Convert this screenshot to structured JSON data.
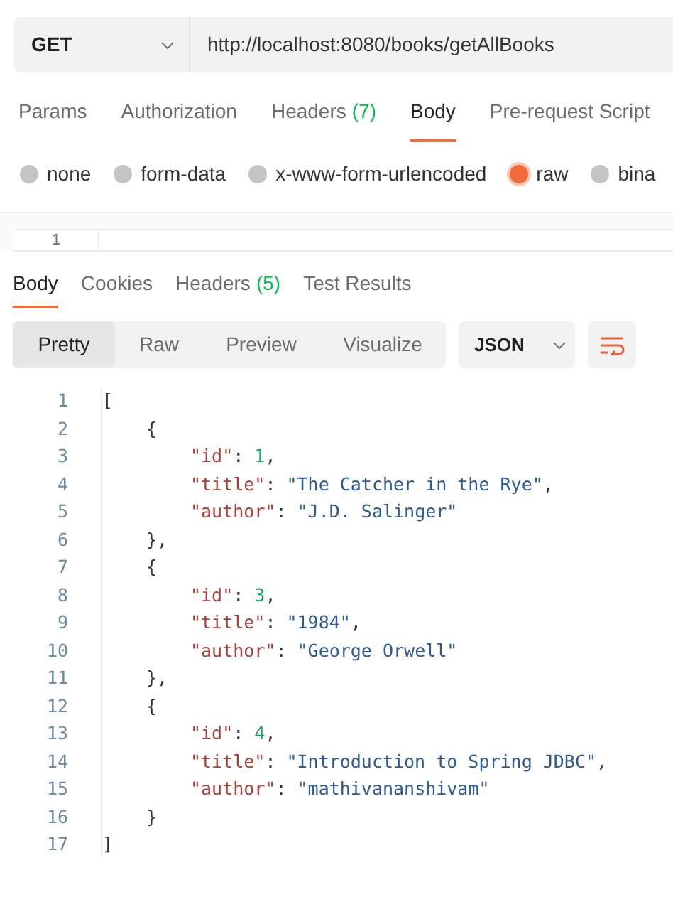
{
  "request": {
    "method": "GET",
    "url": "http://localhost:8080/books/getAllBooks"
  },
  "request_tabs": [
    {
      "label": "Params",
      "selected": false
    },
    {
      "label": "Authorization",
      "selected": false
    },
    {
      "label": "Headers",
      "count": "(7)",
      "selected": false
    },
    {
      "label": "Body",
      "selected": true
    },
    {
      "label": "Pre-request Script",
      "selected": false
    }
  ],
  "body_types": [
    {
      "label": "none",
      "selected": false
    },
    {
      "label": "form-data",
      "selected": false
    },
    {
      "label": "x-www-form-urlencoded",
      "selected": false
    },
    {
      "label": "raw",
      "selected": true
    },
    {
      "label": "bina",
      "selected": false
    }
  ],
  "request_editor": {
    "line_number": "1"
  },
  "response_tabs": [
    {
      "label": "Body",
      "selected": true
    },
    {
      "label": "Cookies",
      "selected": false
    },
    {
      "label": "Headers",
      "count": "(5)",
      "selected": false
    },
    {
      "label": "Test Results",
      "selected": false
    }
  ],
  "view_modes": [
    {
      "label": "Pretty",
      "selected": true
    },
    {
      "label": "Raw",
      "selected": false
    },
    {
      "label": "Preview",
      "selected": false
    },
    {
      "label": "Visualize",
      "selected": false
    }
  ],
  "format": "JSON",
  "code_lines": [
    {
      "number": "1",
      "tokens": [
        {
          "kind": "punct",
          "text": "["
        }
      ],
      "children": [
        {
          "number": "2",
          "tokens": [
            {
              "kind": "punct",
              "text": "{"
            }
          ],
          "children": [
            {
              "number": "3",
              "tokens": [
                {
                  "kind": "key",
                  "text": "\"id\""
                },
                {
                  "kind": "punct",
                  "text": ": "
                },
                {
                  "kind": "number",
                  "text": "1"
                },
                {
                  "kind": "punct",
                  "text": ","
                }
              ]
            },
            {
              "number": "4",
              "tokens": [
                {
                  "kind": "key",
                  "text": "\"title\""
                },
                {
                  "kind": "punct",
                  "text": ": "
                },
                {
                  "kind": "string",
                  "text": "\"The Catcher in the Rye\""
                },
                {
                  "kind": "punct",
                  "text": ","
                }
              ]
            },
            {
              "number": "5",
              "tokens": [
                {
                  "kind": "key",
                  "text": "\"author\""
                },
                {
                  "kind": "punct",
                  "text": ": "
                },
                {
                  "kind": "string",
                  "text": "\"J.D. Salinger\""
                }
              ]
            }
          ]
        },
        {
          "number": "6",
          "tokens": [
            {
              "kind": "punct",
              "text": "},"
            }
          ]
        },
        {
          "number": "7",
          "tokens": [
            {
              "kind": "punct",
              "text": "{"
            }
          ],
          "children": [
            {
              "number": "8",
              "tokens": [
                {
                  "kind": "key",
                  "text": "\"id\""
                },
                {
                  "kind": "punct",
                  "text": ": "
                },
                {
                  "kind": "number",
                  "text": "3"
                },
                {
                  "kind": "punct",
                  "text": ","
                }
              ]
            },
            {
              "number": "9",
              "tokens": [
                {
                  "kind": "key",
                  "text": "\"title\""
                },
                {
                  "kind": "punct",
                  "text": ": "
                },
                {
                  "kind": "string",
                  "text": "\"1984\""
                },
                {
                  "kind": "punct",
                  "text": ","
                }
              ]
            },
            {
              "number": "10",
              "tokens": [
                {
                  "kind": "key",
                  "text": "\"author\""
                },
                {
                  "kind": "punct",
                  "text": ": "
                },
                {
                  "kind": "string",
                  "text": "\"George Orwell\""
                }
              ]
            }
          ]
        },
        {
          "number": "11",
          "tokens": [
            {
              "kind": "punct",
              "text": "},"
            }
          ]
        },
        {
          "number": "12",
          "tokens": [
            {
              "kind": "punct",
              "text": "{"
            }
          ],
          "children": [
            {
              "number": "13",
              "tokens": [
                {
                  "kind": "key",
                  "text": "\"id\""
                },
                {
                  "kind": "punct",
                  "text": ": "
                },
                {
                  "kind": "number",
                  "text": "4"
                },
                {
                  "kind": "punct",
                  "text": ","
                }
              ]
            },
            {
              "number": "14",
              "tokens": [
                {
                  "kind": "key",
                  "text": "\"title\""
                },
                {
                  "kind": "punct",
                  "text": ": "
                },
                {
                  "kind": "string",
                  "text": "\"Introduction to Spring JDBC\""
                },
                {
                  "kind": "punct",
                  "text": ","
                }
              ]
            },
            {
              "number": "15",
              "tokens": [
                {
                  "kind": "key",
                  "text": "\"author\""
                },
                {
                  "kind": "punct",
                  "text": ": "
                },
                {
                  "kind": "string",
                  "text": "\"mathivananshivam\""
                }
              ]
            }
          ]
        },
        {
          "number": "16",
          "tokens": [
            {
              "kind": "punct",
              "text": "}"
            }
          ]
        }
      ]
    },
    {
      "number": "17",
      "tokens": [
        {
          "kind": "punct",
          "text": "]"
        }
      ]
    }
  ]
}
